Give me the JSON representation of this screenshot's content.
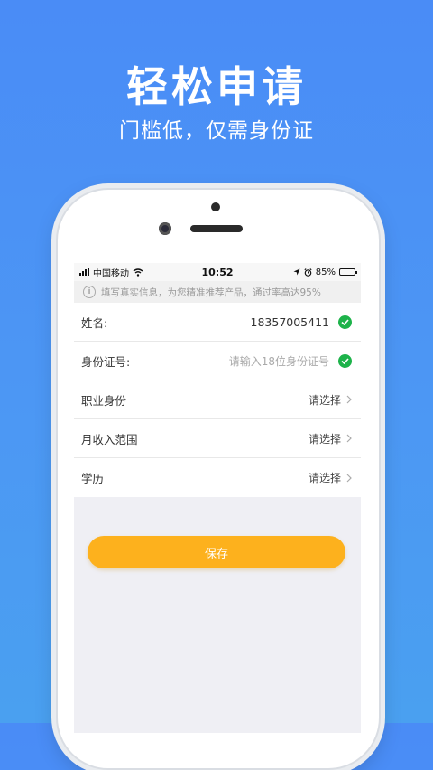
{
  "promo": {
    "headline": "轻松申请",
    "subline": "门槛低，仅需身份证"
  },
  "status_bar": {
    "carrier": "中国移动",
    "time": "10:52",
    "battery": "85%"
  },
  "notice": {
    "text": "填写真实信息，为您精准推荐产品，通过率高达95%"
  },
  "form": {
    "name_label": "姓名:",
    "name_value": "18357005411",
    "id_label": "身份证号:",
    "id_placeholder": "请输入18位身份证号",
    "occupation_label": "职业身份",
    "occupation_value": "请选择",
    "income_label": "月收入范围",
    "income_value": "请选择",
    "education_label": "学历",
    "education_value": "请选择"
  },
  "actions": {
    "save_label": "保存"
  },
  "colors": {
    "background": "#4a8cf6",
    "save_button": "#fdb11d",
    "check": "#1db34a"
  }
}
